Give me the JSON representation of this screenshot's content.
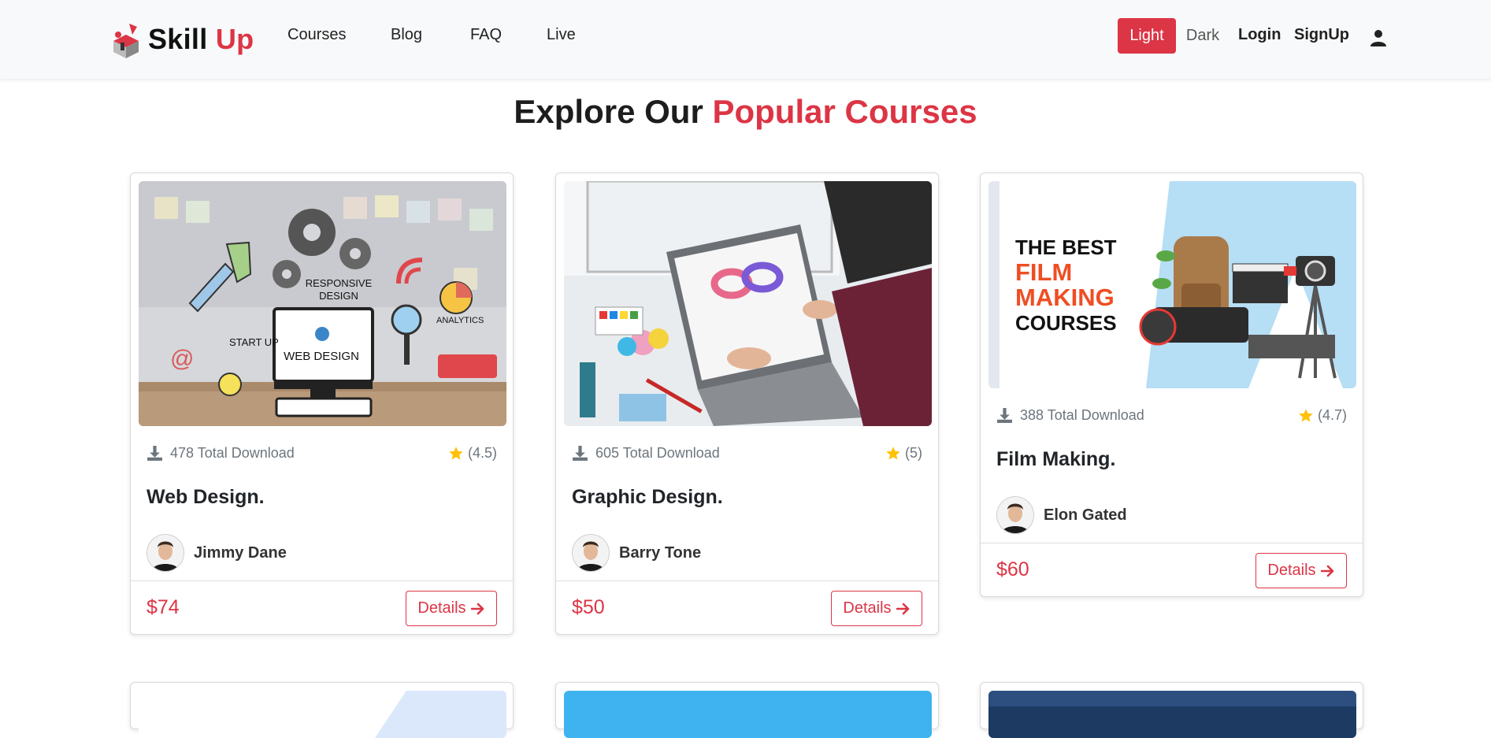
{
  "brand": {
    "name_part1": "Skill",
    "name_part2": "Up"
  },
  "nav": {
    "links": [
      "Courses",
      "Blog",
      "FAQ",
      "Live"
    ]
  },
  "theme": {
    "light_label": "Light",
    "dark_label": "Dark"
  },
  "auth": {
    "login_label": "Login",
    "signup_label": "SignUp"
  },
  "section": {
    "title_part1": "Explore Our",
    "title_part2": "Popular Courses"
  },
  "courses": [
    {
      "title": "Web Design.",
      "downloads": "478 Total Download",
      "rating": "(4.5)",
      "author": "Jimmy Dane",
      "price": "$74",
      "details_label": "Details",
      "image_text": {
        "l1": "RESPONSIVE",
        "l2": "DESIGN",
        "l3": "WEB DESIGN",
        "l4": "START UP",
        "l5": "ANALYTICS"
      }
    },
    {
      "title": "Graphic Design.",
      "downloads": "605 Total Download",
      "rating": "(5)",
      "author": "Barry Tone",
      "price": "$50",
      "details_label": "Details"
    },
    {
      "title": "Film Making.",
      "downloads": "388 Total Download",
      "rating": "(4.7)",
      "author": "Elon Gated",
      "price": "$60",
      "details_label": "Details",
      "image_text": {
        "l1": "THE BEST",
        "l2": "FILM",
        "l3": "MAKING",
        "l4": "COURSES"
      }
    }
  ],
  "colors": {
    "accent": "#dc3545",
    "navbar_bg": "#f8f9fa",
    "star": "#ffc107"
  }
}
